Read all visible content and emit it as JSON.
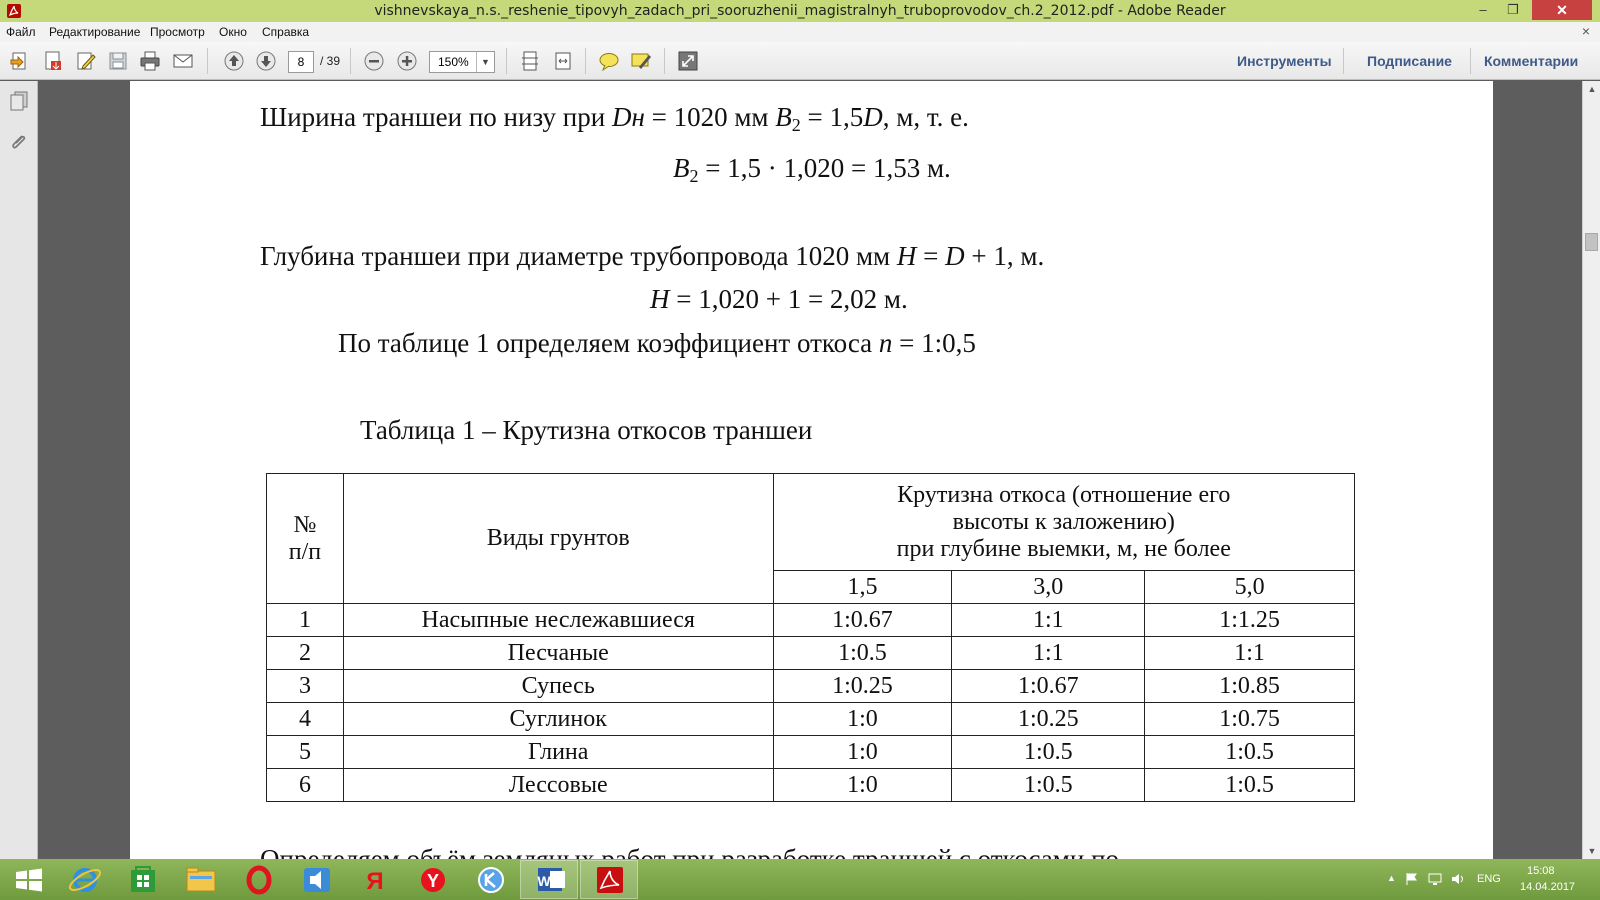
{
  "window": {
    "title": "vishnevskaya_n.s._reshenie_tipovyh_zadach_pri_sooruzhenii_magistralnyh_truboprovodov_ch.2_2012.pdf - Adobe Reader",
    "minimize": "‒",
    "maximize": "❐",
    "close": "✕"
  },
  "menu": {
    "items": [
      "Файл",
      "Редактирование",
      "Просмотр",
      "Окно",
      "Справка"
    ],
    "close_doc": "×"
  },
  "toolbar": {
    "page_current": "8",
    "page_total": "/ 39",
    "zoom": "150%",
    "zoom_dropdown": "▼",
    "tools_label": "Инструменты",
    "sign_label": "Подписание",
    "comment_label": "Комментарии"
  },
  "document": {
    "line1": {
      "pre": "Ширина траншеи по низу при ",
      "var1": "Dн",
      "mid": " = 1020 мм ",
      "var2": "B",
      "sub2": "2",
      "mid2": " = 1,5",
      "var3": "D",
      "post": ", м, т. е."
    },
    "line2": {
      "var": "B",
      "sub": "2",
      "post": " = 1,5 · 1,020 = 1,53 м."
    },
    "line3": {
      "pre": "Глубина траншеи при диаметре трубопровода 1020 мм ",
      "var1": "H",
      "mid": " = ",
      "var2": "D",
      "post": " + 1, м."
    },
    "line4": {
      "var": "H",
      "post": " = 1,020 + 1 = 2,02 м."
    },
    "line5": {
      "pre": "По таблице 1 определяем коэффициент откоса  ",
      "var": "n",
      "post": " = 1:0,5"
    },
    "table_caption": "Таблица 1 – Крутизна откосов траншеи",
    "partial_next_line": "Определяем объём земляных работ при разработке траншей с откосами по"
  },
  "table": {
    "col_num": "№ п/п",
    "col_num_l1": "№",
    "col_num_l2": "п/п",
    "col_soil": "Виды грунтов",
    "col_slope_l1": "Крутизна откоса (отношение его",
    "col_slope_l2": "высоты к заложению)",
    "col_slope_l3": "при глубине выемки, м, не более",
    "depths": [
      "1,5",
      "3,0",
      "5,0"
    ],
    "rows": [
      {
        "num": "1",
        "soil": "Насыпные неслежавшиеся",
        "v": [
          "1:0.67",
          "1:1",
          "1:1.25"
        ]
      },
      {
        "num": "2",
        "soil": "Песчаные",
        "v": [
          "1:0.5",
          "1:1",
          "1:1"
        ]
      },
      {
        "num": "3",
        "soil": "Супесь",
        "v": [
          "1:0.25",
          "1:0.67",
          "1:0.85"
        ]
      },
      {
        "num": "4",
        "soil": "Суглинок",
        "v": [
          "1:0",
          "1:0.25",
          "1:0.75"
        ]
      },
      {
        "num": "5",
        "soil": "Глина",
        "v": [
          "1:0",
          "1:0.5",
          "1:0.5"
        ]
      },
      {
        "num": "6",
        "soil": "Лессовые",
        "v": [
          "1:0",
          "1:0.5",
          "1:0.5"
        ]
      }
    ]
  },
  "taskbar": {
    "apps": [
      "start",
      "internet-explorer",
      "store",
      "file-explorer",
      "opera",
      "media",
      "yandex-browser",
      "yandex",
      "app",
      "word",
      "adobe-reader"
    ],
    "lang": "ENG",
    "time": "15:08",
    "date": "14.04.2017"
  },
  "colors": {
    "titlebar": "#c5d97a",
    "toolbar_link": "#3d5a88",
    "taskbar": "#7fa74a",
    "close_button": "#c74141"
  }
}
